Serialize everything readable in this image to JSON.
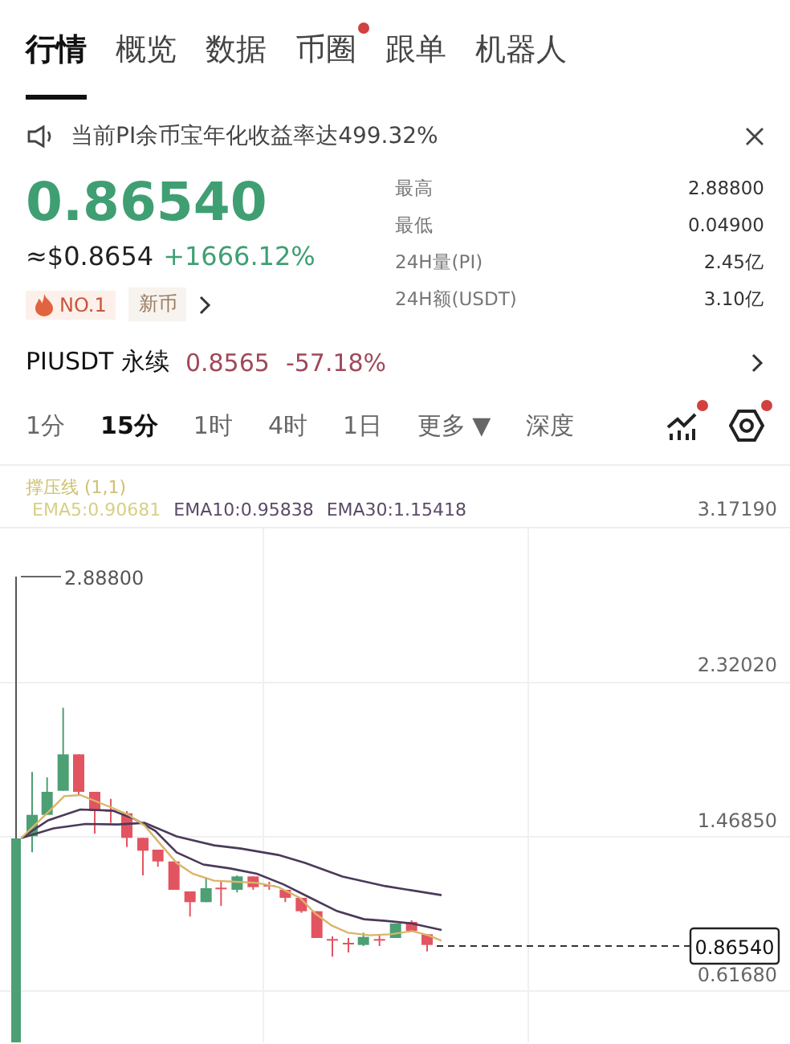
{
  "top_tabs": [
    {
      "label": "行情",
      "selected": true,
      "dot": false
    },
    {
      "label": "概览",
      "selected": false,
      "dot": false
    },
    {
      "label": "数据",
      "selected": false,
      "dot": false
    },
    {
      "label": "币圈",
      "selected": false,
      "dot": true
    },
    {
      "label": "跟单",
      "selected": false,
      "dot": false
    },
    {
      "label": "机器人",
      "selected": false,
      "dot": false
    }
  ],
  "notice": {
    "text": "当前PI余币宝年化收益率达499.32%"
  },
  "price": {
    "last": "0.86540",
    "usd": "≈$0.8654",
    "change": "+1666.12%"
  },
  "stats": [
    {
      "label": "最高",
      "value": "2.88800"
    },
    {
      "label": "最低",
      "value": "0.04900"
    },
    {
      "label": "24H量(PI)",
      "value": "2.45亿"
    },
    {
      "label": "24H额(USDT)",
      "value": "3.10亿"
    }
  ],
  "tags": [
    {
      "label": "NO.1",
      "kind": "hot"
    },
    {
      "label": "新币",
      "kind": "plain"
    }
  ],
  "perpetual": {
    "name": "PIUSDT 永续",
    "price": "0.8565",
    "change": "-57.18%"
  },
  "intervals": [
    {
      "label": "1分",
      "selected": false
    },
    {
      "label": "15分",
      "selected": true
    },
    {
      "label": "1时",
      "selected": false
    },
    {
      "label": "4时",
      "selected": false
    },
    {
      "label": "1日",
      "selected": false
    },
    {
      "label": "更多",
      "selected": false,
      "caret": "▼"
    },
    {
      "label": "深度",
      "selected": false
    }
  ],
  "tools": [
    {
      "kind": "indicator",
      "dot": true
    },
    {
      "kind": "settings",
      "dot": true
    }
  ],
  "legend": {
    "title": "撑压线 (1,1)",
    "ema": [
      {
        "label": "EMA5:0.90681",
        "color": "#d8cf86"
      },
      {
        "label": "EMA10:0.95838",
        "color": "#5a4a66"
      },
      {
        "label": "EMA30:1.15418",
        "color": "#5a4a66"
      }
    ]
  },
  "chart": {
    "axis_labels": [
      "3.17190",
      "2.32020",
      "1.46850",
      "0.61680"
    ],
    "high_marker": "2.88800",
    "current_price": "0.86540"
  }
}
